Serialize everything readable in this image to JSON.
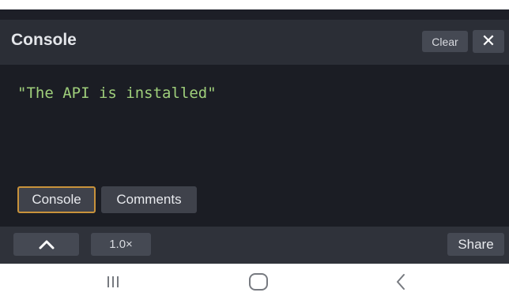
{
  "console": {
    "title": "Console",
    "clear_label": "Clear",
    "close_label": "✕",
    "output_lines": [
      "\"The API is installed\""
    ]
  },
  "tabs": [
    {
      "label": "Console",
      "active": true
    },
    {
      "label": "Comments",
      "active": false
    }
  ],
  "toolbar": {
    "up_icon": "chevron-up-icon",
    "speed_label": "1.0×",
    "share_label": "Share"
  },
  "navbar": {
    "recents_icon": "recents-icon",
    "home_icon": "home-icon",
    "back_icon": "back-icon"
  },
  "colors": {
    "panel_bg": "#1b1d24",
    "header_bg": "#2b2e36",
    "output_text": "#9fcf7b",
    "active_tab_border": "#c8923b"
  }
}
